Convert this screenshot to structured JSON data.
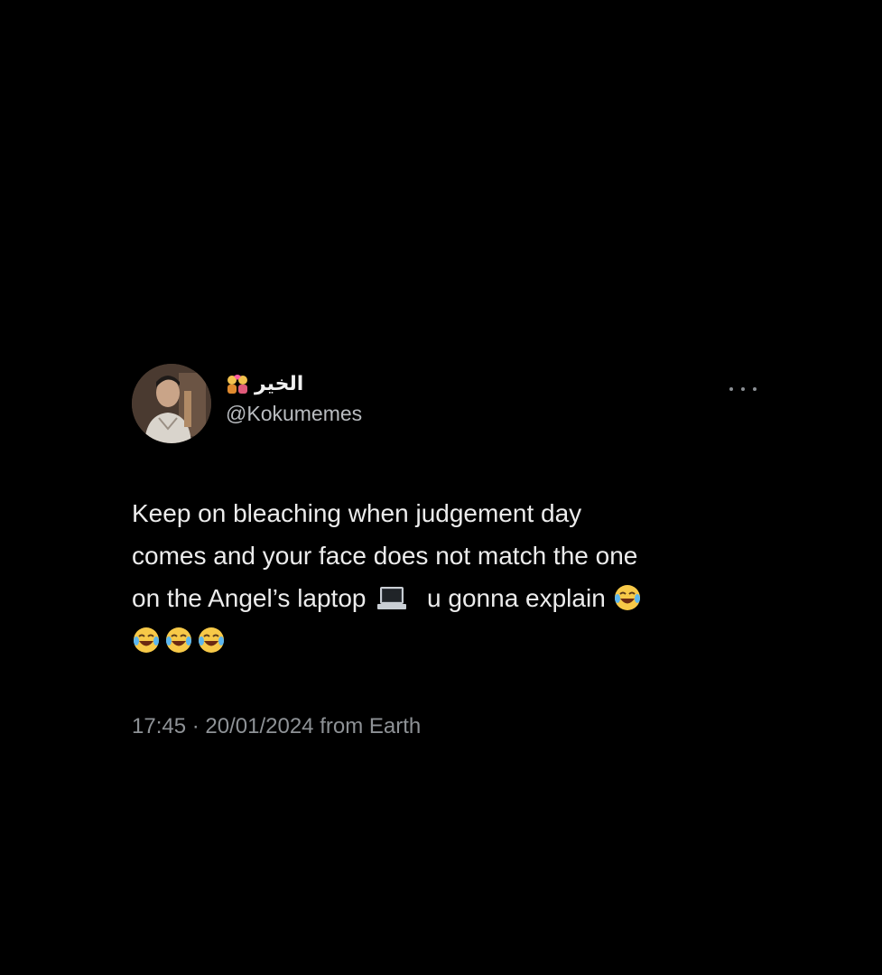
{
  "tweet": {
    "display_name": "الخير",
    "display_name_icon": "couple-with-heart-icon",
    "handle": "@Kokumemes",
    "text_line_1": "Keep on bleaching  when judgement day",
    "text_line_2": "comes and your face does not match the one",
    "text_line_3a": "on the Angel’s laptop",
    "text_line_3b": "u gonna explain",
    "emojis": [
      "laptop-icon",
      "tears-of-joy-icon"
    ],
    "time": "17:45",
    "separator": "·",
    "date": "20/01/2024",
    "source": "from Earth"
  },
  "colors": {
    "background": "#000000",
    "text": "#ececec",
    "secondary": "#8e9296"
  }
}
